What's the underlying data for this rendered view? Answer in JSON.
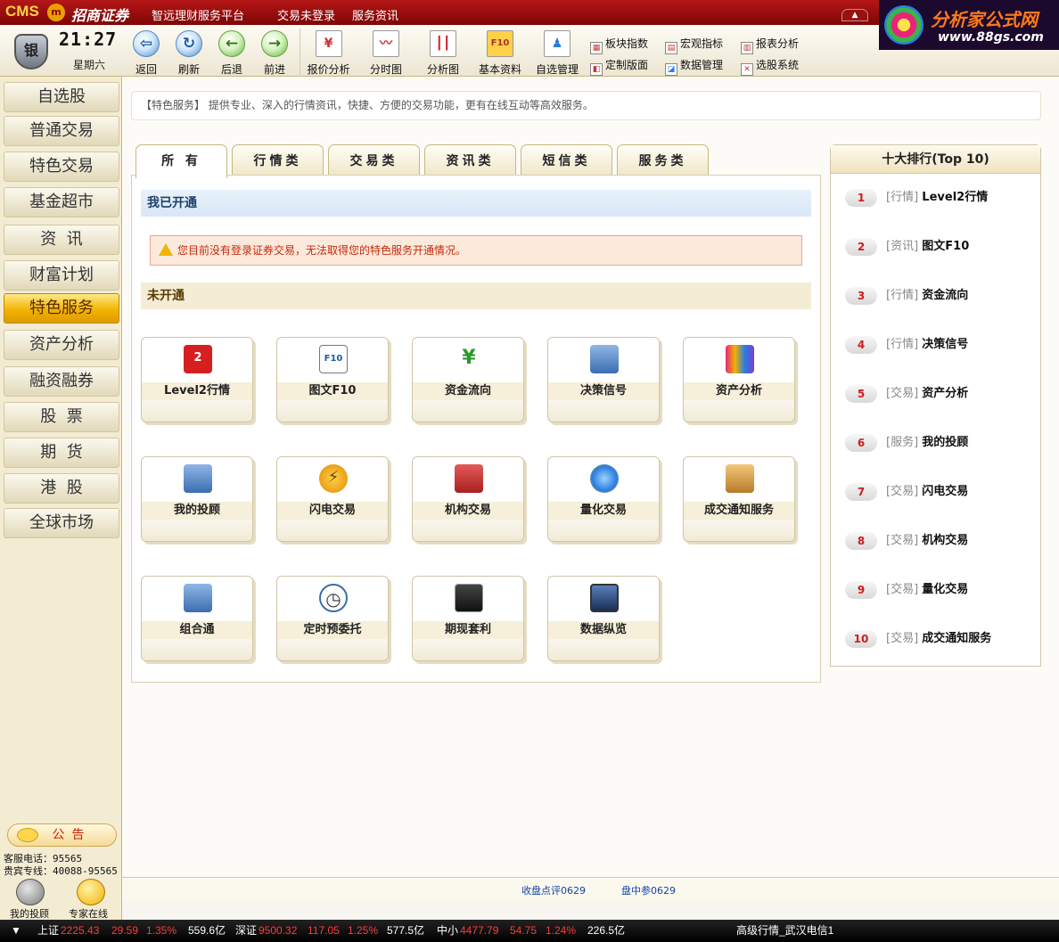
{
  "titlebar": {
    "logo": "CMS",
    "logo_emblem": "m",
    "brand": "招商证券",
    "platform": "智远理财服务平台",
    "login_status": "交易未登录",
    "service_info": "服务资讯"
  },
  "ad": {
    "title": "分析家公式网",
    "url": "www.88gs.com"
  },
  "clock": {
    "time": "21:27",
    "weekday": "星期六",
    "badge": "银"
  },
  "toolbar": {
    "back": "返回",
    "refresh": "刷新",
    "prev": "后退",
    "next": "前进",
    "quote_analysis": "报价分析",
    "timeshare": "分时图",
    "analysis_chart": "分析图",
    "basic_info": "基本资料",
    "watchlist_manage": "自选管理",
    "sector_index": "板块指数",
    "macro_index": "宏观指标",
    "report_analysis": "报表分析",
    "custom_layout": "定制版面",
    "data_manage": "数据管理",
    "stock_select": "选股系统"
  },
  "sidebar": {
    "items": [
      {
        "label": "自选股"
      },
      {
        "label": "普通交易"
      },
      {
        "label": "特色交易"
      },
      {
        "label": "基金超市"
      },
      {
        "label": "资  讯"
      },
      {
        "label": "财富计划"
      },
      {
        "label": "特色服务"
      },
      {
        "label": "资产分析"
      },
      {
        "label": "融资融券"
      },
      {
        "label": "股  票"
      },
      {
        "label": "期  货"
      },
      {
        "label": "港  股"
      },
      {
        "label": "全球市场"
      }
    ],
    "active": "特色服务",
    "notice": "公告",
    "hotline1": "客服电话：95565",
    "hotline2": "贵宾专线：40088-95565",
    "my_advisor": "我的投顾",
    "expert_online": "专家在线"
  },
  "banner": "【特色服务】 提供专业、深入的行情资讯，快捷、方便的交易功能，更有在线互动等高效服务。",
  "tabs": [
    "所 有",
    "行情类",
    "交易类",
    "资讯类",
    "短信类",
    "服务类"
  ],
  "section_opened": "我已开通",
  "warning": "您目前没有登录证券交易，无法取得您的特色服务开通情况。",
  "section_unopened": "未开通",
  "services": [
    {
      "label": "Level2行情",
      "icon": "2"
    },
    {
      "label": "图文F10",
      "icon": "F10"
    },
    {
      "label": "资金流向",
      "icon": "¥"
    },
    {
      "label": "决策信号",
      "icon": ""
    },
    {
      "label": "资产分析",
      "icon": ""
    },
    {
      "label": "我的投顾",
      "icon": ""
    },
    {
      "label": "闪电交易",
      "icon": "⚡"
    },
    {
      "label": "机构交易",
      "icon": ""
    },
    {
      "label": "量化交易",
      "icon": ""
    },
    {
      "label": "成交通知服务",
      "icon": ""
    },
    {
      "label": "组合通",
      "icon": ""
    },
    {
      "label": "定时预委托",
      "icon": "◷"
    },
    {
      "label": "期现套利",
      "icon": ""
    },
    {
      "label": "数据纵览",
      "icon": ""
    }
  ],
  "ranking": {
    "title": "十大排行(Top 10)",
    "items": [
      {
        "num": "1",
        "cat": "[行情]",
        "name": "Level2行情"
      },
      {
        "num": "2",
        "cat": "[资讯]",
        "name": "图文F10"
      },
      {
        "num": "3",
        "cat": "[行情]",
        "name": "资金流向"
      },
      {
        "num": "4",
        "cat": "[行情]",
        "name": "决策信号"
      },
      {
        "num": "5",
        "cat": "[交易]",
        "name": "资产分析"
      },
      {
        "num": "6",
        "cat": "[服务]",
        "name": "我的投顾"
      },
      {
        "num": "7",
        "cat": "[交易]",
        "name": "闪电交易"
      },
      {
        "num": "8",
        "cat": "[交易]",
        "name": "机构交易"
      },
      {
        "num": "9",
        "cat": "[交易]",
        "name": "量化交易"
      },
      {
        "num": "10",
        "cat": "[交易]",
        "name": "成交通知服务"
      }
    ]
  },
  "links": {
    "closing_review": "收盘点评0629",
    "midday": "盘中参0629"
  },
  "status": {
    "sh_label": "上证",
    "sh_value": "2225.43",
    "sh_change": "29.59",
    "sh_pct": "1.35%",
    "sh_vol": "559.6亿",
    "sz_label": "深证",
    "sz_value": "9500.32",
    "sz_change": "117.05",
    "sz_pct": "1.25%",
    "sz_vol": "577.5亿",
    "zx_label": "中小",
    "zx_value": "4477.79",
    "zx_change": "54.75",
    "zx_pct": "1.24%",
    "zx_vol": "226.5亿",
    "feed": "高级行情_武汉电信1"
  },
  "colors": {
    "accent": "#a50d0d",
    "active_nav": "#f1b400",
    "up": "#ff3b3b"
  }
}
